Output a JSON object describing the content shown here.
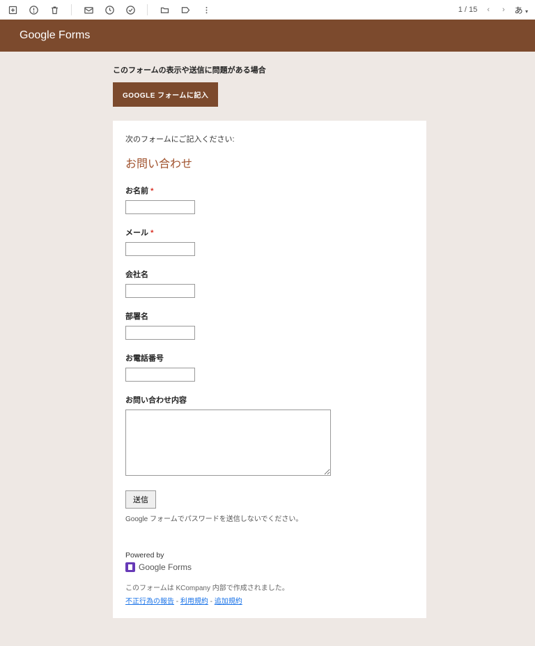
{
  "toolbar": {
    "page_indicator": "1 / 15",
    "language": "あ"
  },
  "header": {
    "logo_prefix": "Google",
    "logo_suffix": " Forms"
  },
  "trouble": {
    "message": "このフォームの表示や送信に問題がある場合",
    "button": "GOOGLE フォームに記入"
  },
  "form": {
    "instruction": "次のフォームにご記入ください:",
    "title": "お問い合わせ",
    "fields": {
      "name": {
        "label": "お名前",
        "required": "*"
      },
      "email": {
        "label": "メール",
        "required": "*"
      },
      "company": {
        "label": "会社名"
      },
      "department": {
        "label": "部署名"
      },
      "phone": {
        "label": "お電話番号"
      },
      "inquiry": {
        "label": "お問い合わせ内容"
      }
    },
    "submit": "送信",
    "password_warning": "Google フォームでパスワードを送信しないでください。"
  },
  "footer": {
    "powered_by": "Powered by",
    "forms_prefix": "Google",
    "forms_suffix": " Forms",
    "created_in": "このフォームは KCompany 内部で作成されました。",
    "links": {
      "abuse": "不正行為の報告",
      "terms": "利用規約",
      "additional": "追加規約"
    },
    "dash": " - "
  }
}
